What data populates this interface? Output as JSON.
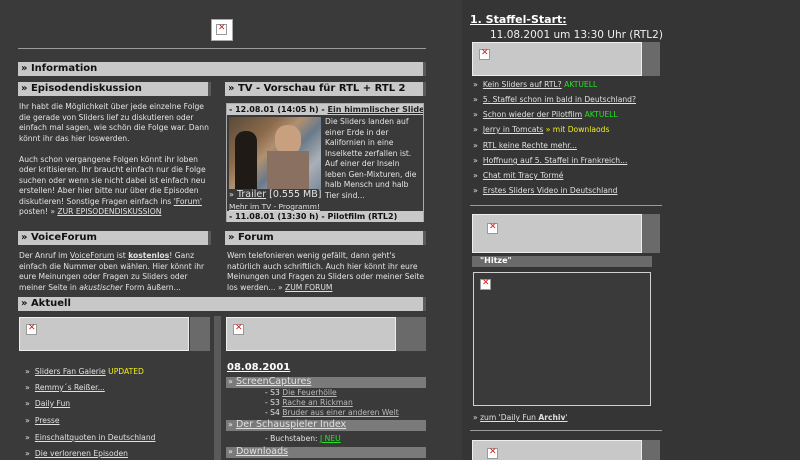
{
  "information": {
    "header": "» Information"
  },
  "episoden": {
    "header": "» Episodendiskussion",
    "para1": "Ihr habt die Möglichkeit über jede einzelne Folge die gerade von Sliders lief zu diskutieren oder einfach mal sagen, wie schön die Folge war. Dann könnt ihr das hier loswerden.",
    "para2a": "Auch schon vergangene Folgen könnt ihr loben oder kritisieren. Ihr braucht einfach nur die Folge suchen oder wenn sie nicht dabei ist einfach neu erstellen! Aber hier bitte nur über die Episoden diskutieren! Sonstige Fragen einfach ins ",
    "forum_link": "'Forum'",
    "para2b": " posten! » ",
    "link": "ZUR EPISODENDISKUSSION"
  },
  "tv": {
    "header": "» TV - Vorschau für RTL + RTL 2",
    "row1_prefix": "- 12.08.01 (14:05 h) - ",
    "row1_link": "Ein himmlischer Slide",
    "desc": "Die Sliders landen auf einer Erde in der Kalifornien in eine Inselkette zerfallen ist. Auf einer der Inseln leben Gen-Mixturen, die halb Mensch und halb Tier sind...",
    "trailer_link": "Trailer",
    "trailer_size": " [0.555 MB]",
    "more_link": "Mehr im TV - Programm!",
    "row2_prefix": "- 11.08.01 (13:30 h) - ",
    "row2_bold": "Pilotfilm",
    "row2_suffix": " (RTL2)"
  },
  "voiceforum": {
    "header": "» VoiceForum",
    "t1": "Der Anruf im ",
    "link1": "VoiceForum",
    "t2": " ist ",
    "bold": "kostenlos",
    "t3": "! Ganz einfach die Nummer oben wählen. Hier könnt ihr eure Meinungen oder Fragen zu Sliders oder meiner Seite in ",
    "italic": "akustischer",
    "t4": " Form äußern..."
  },
  "forum": {
    "header": "» Forum",
    "text": "Wem telefonieren wenig gefällt, dann geht's natürlich auch schriftlich. Auch hier könnt ihr eure Meinungen und Fragen zu Sliders oder meiner Seite los werden... » ",
    "link": "ZUM FORUM"
  },
  "aktuell": {
    "header": "» Aktuell",
    "items": [
      {
        "label": "Sliders Fan Galerie",
        "badge": " UPDATED"
      },
      {
        "label": "Remmy´s Reißer...",
        "badge": ""
      },
      {
        "label": "Daily Fun",
        "badge": ""
      },
      {
        "label": "Presse",
        "badge": ""
      },
      {
        "label": "Einschaltquoten in Deutschland",
        "badge": ""
      },
      {
        "label": "Die verlorenen Episoden",
        "badge": ""
      }
    ],
    "date": "08.08.2001",
    "screencaptures": "ScreenCaptures",
    "sc_items": [
      {
        "prefix": "- S3 ",
        "label": "Die Feuerhölle"
      },
      {
        "prefix": "- S3 ",
        "label": "Rache an Rickman"
      },
      {
        "prefix": "- S4 ",
        "label": "Bruder aus einer anderen Welt"
      }
    ],
    "schauspieler": "Der Schauspieler Index",
    "buchstaben": "- Buchstaben: ",
    "buchstaben_value": "J NEU",
    "downloads": "Downloads"
  },
  "sidebar": {
    "staffel_title": "1. Staffel-Start:",
    "staffel_date": "11.08.2001 um 13:30 Uhr (RTL2)",
    "news": [
      {
        "label": "Kein Sliders auf RTL?",
        "badge": " AKTUELL",
        "badge_color": "green"
      },
      {
        "label": "5. Staffel schon im bald in Deutschland?",
        "badge": "",
        "badge_color": ""
      },
      {
        "label": "Schon wieder der Pilotfilm",
        "badge": " AKTUELL",
        "badge_color": "green"
      },
      {
        "label": "Jerry in Tomcats",
        "badge": " » mit Downlaods",
        "badge_color": "yellow"
      },
      {
        "label": "RTL keine Rechte mehr...",
        "badge": "",
        "badge_color": ""
      },
      {
        "label": "Hoffnung auf 5. Staffel in Frankreich...",
        "badge": "",
        "badge_color": ""
      },
      {
        "label": "Chat mit Tracy Tormé",
        "badge": "",
        "badge_color": ""
      },
      {
        "label": "Erstes Sliders Video in Deutschland",
        "badge": "",
        "badge_color": ""
      }
    ],
    "hitze_label": "\"Hitze\"",
    "dailyfun_prefix": "» ",
    "dailyfun_link_a": "zum 'Daily Fun ",
    "dailyfun_link_b": "Archiv",
    "dailyfun_link_c": "'"
  }
}
